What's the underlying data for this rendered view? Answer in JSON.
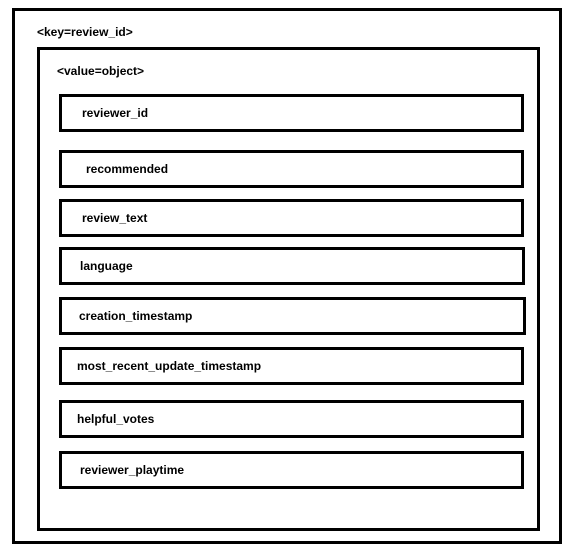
{
  "diagram": {
    "key_label": "<key=review_id>",
    "value_label": "<value=object>",
    "fields": [
      "reviewer_id",
      "recommended",
      "review_text",
      "language",
      "creation_timestamp",
      "most_recent_update_timestamp",
      "helpful_votes",
      "reviewer_playtime"
    ]
  }
}
